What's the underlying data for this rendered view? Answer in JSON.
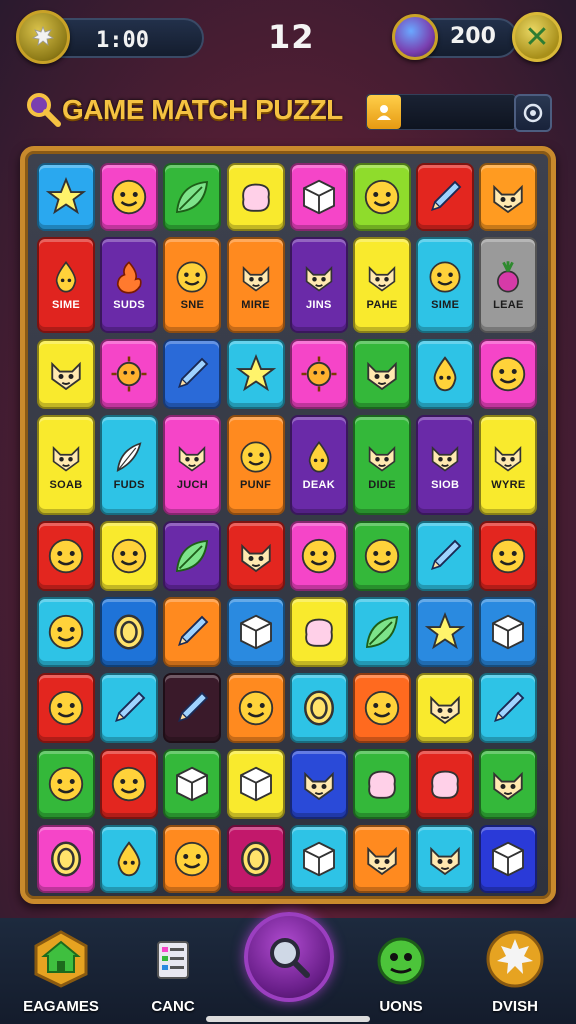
{
  "hud": {
    "timer": "1:00",
    "level": "12",
    "coins": "200"
  },
  "title": {
    "text": "GAME MATCH PUZZL"
  },
  "board": {
    "rows": [
      [
        {
          "color": "#2aa8ef",
          "shape": "star",
          "label": ""
        },
        {
          "color": "#f545c8",
          "shape": "face",
          "label": ""
        },
        {
          "color": "#34b83a",
          "shape": "leaf",
          "label": ""
        },
        {
          "color": "#f9ea2d",
          "shape": "blob",
          "label": ""
        },
        {
          "color": "#f545c8",
          "shape": "cube",
          "label": ""
        },
        {
          "color": "#8fdc2c",
          "shape": "face",
          "label": ""
        },
        {
          "color": "#e3261f",
          "shape": "pencil",
          "label": ""
        },
        {
          "color": "#ff9b21",
          "shape": "cat",
          "label": ""
        }
      ],
      [
        {
          "color": "#e0241f",
          "shape": "drop",
          "label": "SIME"
        },
        {
          "color": "#6a2aa8",
          "shape": "flame",
          "label": "SUDS"
        },
        {
          "color": "#ff8a1f",
          "shape": "face",
          "label": "SNE"
        },
        {
          "color": "#ff8a1f",
          "shape": "cat",
          "label": "MIRE"
        },
        {
          "color": "#6a2aa8",
          "shape": "cat",
          "label": "JINS"
        },
        {
          "color": "#f9ea2d",
          "shape": "cat",
          "label": "PAHE"
        },
        {
          "color": "#2ec3e6",
          "shape": "face",
          "label": "SIME"
        },
        {
          "color": "#9a9a9a",
          "shape": "turnip",
          "label": "LEAE"
        }
      ],
      [
        {
          "color": "#f9ea2d",
          "shape": "cat",
          "label": ""
        },
        {
          "color": "#f545c8",
          "shape": "sun",
          "label": ""
        },
        {
          "color": "#2a6ad8",
          "shape": "pencil",
          "label": ""
        },
        {
          "color": "#2ec3e6",
          "shape": "star",
          "label": ""
        },
        {
          "color": "#f545c8",
          "shape": "sun",
          "label": ""
        },
        {
          "color": "#34b83a",
          "shape": "cat",
          "label": ""
        },
        {
          "color": "#2ec3e6",
          "shape": "drop",
          "label": ""
        },
        {
          "color": "#f545c8",
          "shape": "face",
          "label": ""
        }
      ],
      [
        {
          "color": "#f9ea2d",
          "shape": "cat",
          "label": "SOAB"
        },
        {
          "color": "#2ec3e6",
          "shape": "feather",
          "label": "FUDS"
        },
        {
          "color": "#f545c8",
          "shape": "cat",
          "label": "JUCH"
        },
        {
          "color": "#ff8a1f",
          "shape": "face",
          "label": "PUNF"
        },
        {
          "color": "#6a2aa8",
          "shape": "drop",
          "label": "DEAK"
        },
        {
          "color": "#34b83a",
          "shape": "cat",
          "label": "DIDE"
        },
        {
          "color": "#6a2aa8",
          "shape": "cat",
          "label": "SIOB"
        },
        {
          "color": "#f9ea2d",
          "shape": "cat",
          "label": "WYRE"
        }
      ],
      [
        {
          "color": "#e3261f",
          "shape": "face",
          "label": ""
        },
        {
          "color": "#f9ea2d",
          "shape": "face",
          "label": ""
        },
        {
          "color": "#6a2aa8",
          "shape": "leaf",
          "label": ""
        },
        {
          "color": "#e3261f",
          "shape": "cat",
          "label": ""
        },
        {
          "color": "#f545c8",
          "shape": "face",
          "label": ""
        },
        {
          "color": "#34b83a",
          "shape": "face",
          "label": ""
        },
        {
          "color": "#2ec3e6",
          "shape": "pencil",
          "label": ""
        },
        {
          "color": "#e3261f",
          "shape": "face",
          "label": ""
        }
      ],
      [
        {
          "color": "#2ec3e6",
          "shape": "face",
          "label": ""
        },
        {
          "color": "#1e73d8",
          "shape": "ring",
          "label": ""
        },
        {
          "color": "#ff8a1f",
          "shape": "pencil",
          "label": ""
        },
        {
          "color": "#2a8ae0",
          "shape": "cube",
          "label": ""
        },
        {
          "color": "#f9ea2d",
          "shape": "blob",
          "label": ""
        },
        {
          "color": "#2ec3e6",
          "shape": "leaf",
          "label": ""
        },
        {
          "color": "#2a8ae0",
          "shape": "star",
          "label": ""
        },
        {
          "color": "#2a8ae0",
          "shape": "cube",
          "label": ""
        }
      ],
      [
        {
          "color": "#e3261f",
          "shape": "face",
          "label": ""
        },
        {
          "color": "#2ec3e6",
          "shape": "pencil",
          "label": ""
        },
        {
          "color": "#3a1a2a",
          "shape": "pencil",
          "label": ""
        },
        {
          "color": "#ff8a1f",
          "shape": "face",
          "label": ""
        },
        {
          "color": "#2ec3e6",
          "shape": "ring",
          "label": ""
        },
        {
          "color": "#ff6a1f",
          "shape": "face",
          "label": ""
        },
        {
          "color": "#f9ea2d",
          "shape": "cat",
          "label": ""
        },
        {
          "color": "#2ec3e6",
          "shape": "pencil",
          "label": ""
        }
      ],
      [
        {
          "color": "#34b83a",
          "shape": "face",
          "label": ""
        },
        {
          "color": "#e3261f",
          "shape": "face",
          "label": ""
        },
        {
          "color": "#34b83a",
          "shape": "cube",
          "label": ""
        },
        {
          "color": "#f9ea2d",
          "shape": "cube",
          "label": ""
        },
        {
          "color": "#2a4ad8",
          "shape": "cat",
          "label": ""
        },
        {
          "color": "#34b83a",
          "shape": "blob",
          "label": ""
        },
        {
          "color": "#e3261f",
          "shape": "blob",
          "label": ""
        },
        {
          "color": "#34b83a",
          "shape": "cat",
          "label": ""
        }
      ],
      [
        {
          "color": "#f545c8",
          "shape": "ring",
          "label": ""
        },
        {
          "color": "#2ec3e6",
          "shape": "drop",
          "label": ""
        },
        {
          "color": "#ff8a1f",
          "shape": "face",
          "label": ""
        },
        {
          "color": "#c2186b",
          "shape": "ring",
          "label": ""
        },
        {
          "color": "#2ec3e6",
          "shape": "cube",
          "label": ""
        },
        {
          "color": "#ff8a1f",
          "shape": "cat",
          "label": ""
        },
        {
          "color": "#2ec3e6",
          "shape": "cat",
          "label": ""
        },
        {
          "color": "#2a3ad8",
          "shape": "cube",
          "label": ""
        }
      ]
    ]
  },
  "nav": {
    "items": [
      {
        "label": "EAGAMES",
        "icon": "home-icon"
      },
      {
        "label": "CANC",
        "icon": "list-icon"
      },
      {
        "label": "UONS",
        "icon": "monster-icon"
      },
      {
        "label": "DVISH",
        "icon": "bubble-icon"
      }
    ],
    "center_icon": "magnifier-icon"
  }
}
